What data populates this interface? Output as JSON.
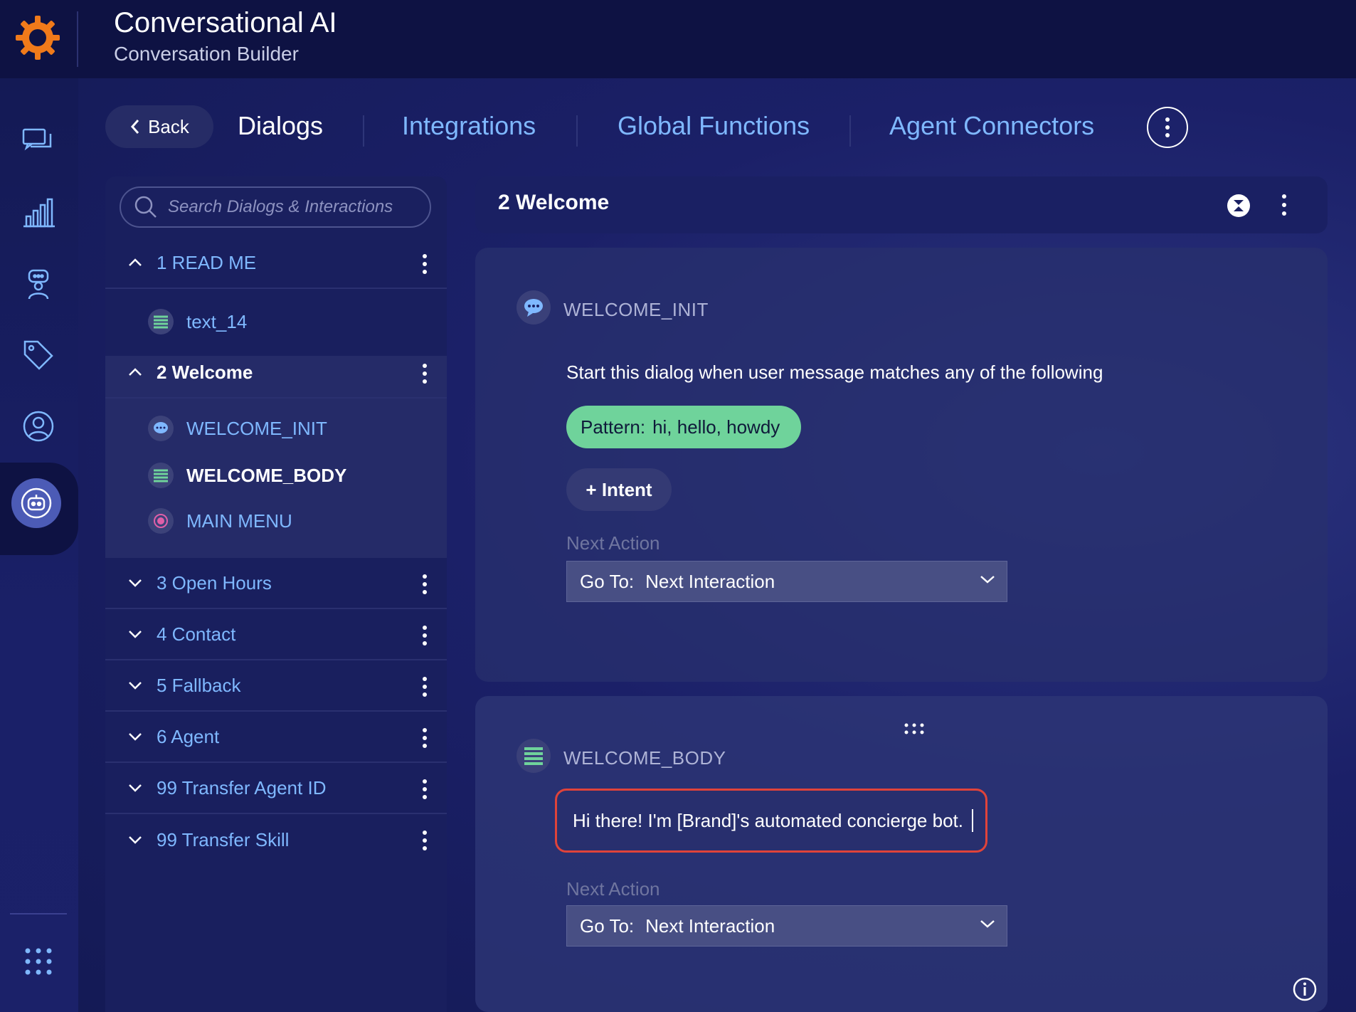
{
  "app": {
    "title": "Conversational AI",
    "subtitle": "Conversation Builder",
    "accent": "#f07a1a"
  },
  "rail": {
    "icons": [
      "conversations-icon",
      "analytics-icon",
      "agent-icon",
      "tag-icon",
      "user-icon",
      "bot-icon",
      "apps-grid-icon"
    ],
    "active": "bot-icon"
  },
  "nav": {
    "back_label": "Back",
    "tabs": [
      {
        "label": "Dialogs",
        "active": true
      },
      {
        "label": "Integrations",
        "active": false
      },
      {
        "label": "Global Functions",
        "active": false
      },
      {
        "label": "Agent Connectors",
        "active": false
      }
    ]
  },
  "search": {
    "placeholder": "Search Dialogs & Interactions",
    "value": ""
  },
  "dialogs": [
    {
      "label": "1 READ ME",
      "expanded": true,
      "children": [
        {
          "label": "text_14",
          "type": "text"
        }
      ]
    },
    {
      "label": "2 Welcome",
      "expanded": true,
      "selected": true,
      "children": [
        {
          "label": "WELCOME_INIT",
          "type": "user"
        },
        {
          "label": "WELCOME_BODY",
          "type": "text",
          "active": true
        },
        {
          "label": "MAIN MENU",
          "type": "question"
        }
      ]
    },
    {
      "label": "3 Open Hours",
      "expanded": false
    },
    {
      "label": "4 Contact",
      "expanded": false
    },
    {
      "label": "5 Fallback",
      "expanded": false
    },
    {
      "label": "6 Agent",
      "expanded": false
    },
    {
      "label": "99 Transfer Agent ID",
      "expanded": false
    },
    {
      "label": "99 Transfer Skill",
      "expanded": false
    }
  ],
  "editor": {
    "dialog_title": "2 Welcome",
    "init": {
      "name": "WELCOME_INIT",
      "description": "Start this dialog when user message matches any of the following",
      "pattern_label": "Pattern:",
      "pattern_value": "hi, hello, howdy",
      "intent_button": "+ Intent",
      "next_action_label": "Next Action",
      "goto_label": "Go To:",
      "goto_value": "Next Interaction"
    },
    "body": {
      "name": "WELCOME_BODY",
      "text": "Hi there! I'm [Brand]'s automated concierge bot.",
      "next_action_label": "Next Action",
      "goto_label": "Go To:",
      "goto_value": "Next Interaction"
    }
  },
  "colors": {
    "pattern_pill": "#6fd39b",
    "link": "#7fb8ff",
    "highlight_border": "#e0433a"
  }
}
